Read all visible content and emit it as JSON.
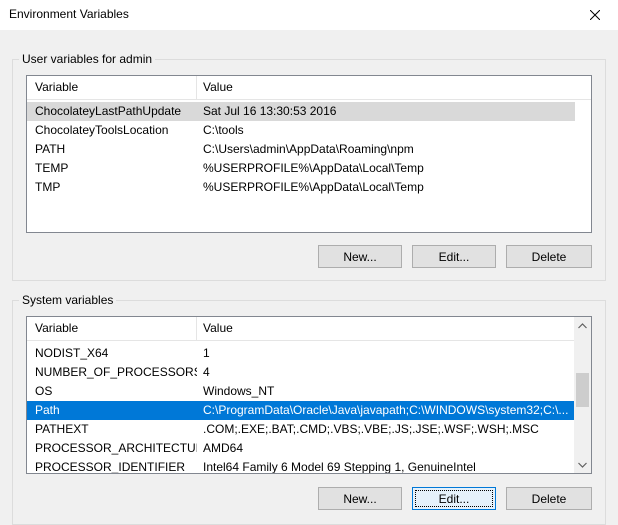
{
  "window": {
    "title": "Environment Variables"
  },
  "user_section": {
    "label": "User variables for admin",
    "columns": [
      "Variable",
      "Value"
    ],
    "rows": [
      {
        "variable": "ChocolateyLastPathUpdate",
        "value": "Sat Jul 16 13:30:53 2016"
      },
      {
        "variable": "ChocolateyToolsLocation",
        "value": "C:\\tools"
      },
      {
        "variable": "PATH",
        "value": "C:\\Users\\admin\\AppData\\Roaming\\npm"
      },
      {
        "variable": "TEMP",
        "value": "%USERPROFILE%\\AppData\\Local\\Temp"
      },
      {
        "variable": "TMP",
        "value": "%USERPROFILE%\\AppData\\Local\\Temp"
      }
    ],
    "buttons": {
      "new": "New...",
      "edit": "Edit...",
      "delete": "Delete"
    }
  },
  "system_section": {
    "label": "System variables",
    "columns": [
      "Variable",
      "Value"
    ],
    "rows": [
      {
        "variable": "NODIST_X64",
        "value": "1"
      },
      {
        "variable": "NUMBER_OF_PROCESSORS",
        "value": "4"
      },
      {
        "variable": "OS",
        "value": "Windows_NT"
      },
      {
        "variable": "Path",
        "value": "C:\\ProgramData\\Oracle\\Java\\javapath;C:\\WINDOWS\\system32;C:\\..."
      },
      {
        "variable": "PATHEXT",
        "value": ".COM;.EXE;.BAT;.CMD;.VBS;.VBE;.JS;.JSE;.WSF;.WSH;.MSC"
      },
      {
        "variable": "PROCESSOR_ARCHITECTURE",
        "value": "AMD64"
      },
      {
        "variable": "PROCESSOR_IDENTIFIER",
        "value": "Intel64 Family 6 Model 69 Stepping 1, GenuineIntel"
      }
    ],
    "buttons": {
      "new": "New...",
      "edit": "Edit...",
      "delete": "Delete"
    }
  },
  "colors": {
    "selection_active": "#0078d7",
    "selection_inactive": "#d9d9d9",
    "background": "#f0f0f0"
  },
  "icons": {
    "close": "close-icon",
    "scroll_up": "chevron-up-icon",
    "scroll_down": "chevron-down-icon"
  }
}
